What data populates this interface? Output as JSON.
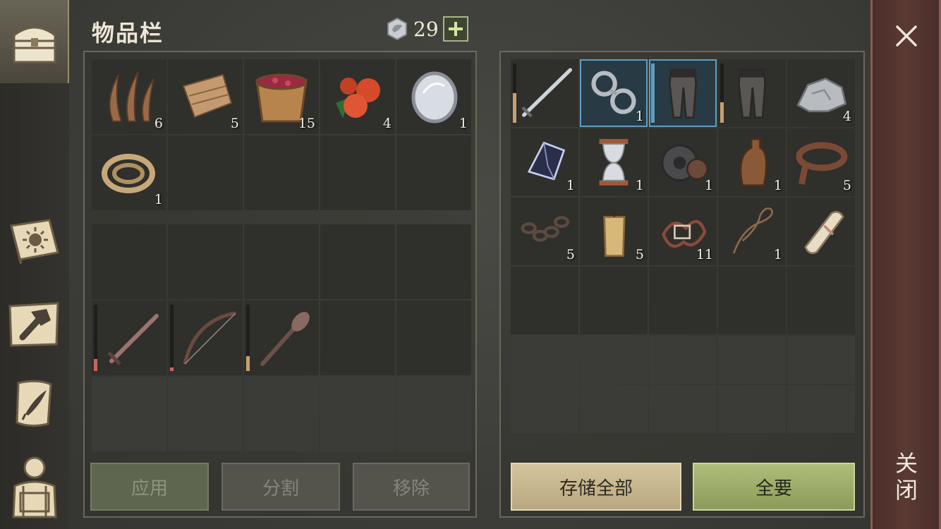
{
  "header": {
    "title": "物品栏",
    "currency_count": "29",
    "currency_icon": "gem-coin-icon",
    "add_label": "+"
  },
  "nav": {
    "tabs": [
      {
        "name": "chest-icon",
        "active": true
      },
      {
        "name": "sun-book-icon"
      },
      {
        "name": "crafting-hammer-icon"
      },
      {
        "name": "quill-scroll-icon"
      },
      {
        "name": "character-backpack-icon"
      }
    ]
  },
  "inventory": {
    "items": [
      {
        "icon": "fiber-icon",
        "qty": "6"
      },
      {
        "icon": "leather-scraps-icon",
        "qty": "5"
      },
      {
        "icon": "berry-bucket-icon",
        "qty": "15"
      },
      {
        "icon": "red-berries-icon",
        "qty": "4"
      },
      {
        "icon": "silver-mirror-icon",
        "qty": "1"
      },
      {
        "icon": "rope-icon",
        "qty": "1"
      }
    ],
    "weapons": [
      {
        "icon": "sword-icon",
        "durability": 0.18,
        "durability_color": "#c4685a"
      },
      {
        "icon": "bow-icon",
        "durability": 0.05,
        "durability_color": "#c4685a"
      },
      {
        "icon": "mace-icon",
        "durability": 0.22,
        "durability_color": "#c8a070"
      }
    ]
  },
  "storage": {
    "items": [
      {
        "icon": "steel-sword-icon",
        "qty": "",
        "durability": 0.5,
        "durability_color": "#c8a070"
      },
      {
        "icon": "shackles-icon",
        "qty": "1",
        "selected": true
      },
      {
        "icon": "chainmail-leggings-icon",
        "qty": "",
        "selected": true,
        "durability": 1.0,
        "durability_color": "#5e9dc4"
      },
      {
        "icon": "chainmail-leggings-icon",
        "qty": "",
        "durability": 0.35,
        "durability_color": "#c8a070"
      },
      {
        "icon": "stone-ore-icon",
        "qty": "4"
      },
      {
        "icon": "dark-crystal-icon",
        "qty": "1"
      },
      {
        "icon": "hourglass-icon",
        "qty": "1"
      },
      {
        "icon": "gear-icon",
        "qty": "1"
      },
      {
        "icon": "leather-flask-icon",
        "qty": "1"
      },
      {
        "icon": "leather-strap-icon",
        "qty": "5"
      },
      {
        "icon": "iron-chain-icon",
        "qty": "5"
      },
      {
        "icon": "candle-icon",
        "qty": "5"
      },
      {
        "icon": "tangled-scrap-icon",
        "qty": "11"
      },
      {
        "icon": "lasso-icon",
        "qty": "1"
      },
      {
        "icon": "parchment-scroll-icon",
        "qty": ""
      }
    ]
  },
  "buttons": {
    "apply": "应用",
    "split": "分割",
    "remove": "移除",
    "store_all": "存储全部",
    "take_all": "全要"
  },
  "close": {
    "label": "关闭"
  },
  "colors": {
    "accent_select": "#5e9dc4",
    "take_green": "#9aab66",
    "store_tan": "#c9b88e",
    "close_red": "#5a3a33"
  }
}
